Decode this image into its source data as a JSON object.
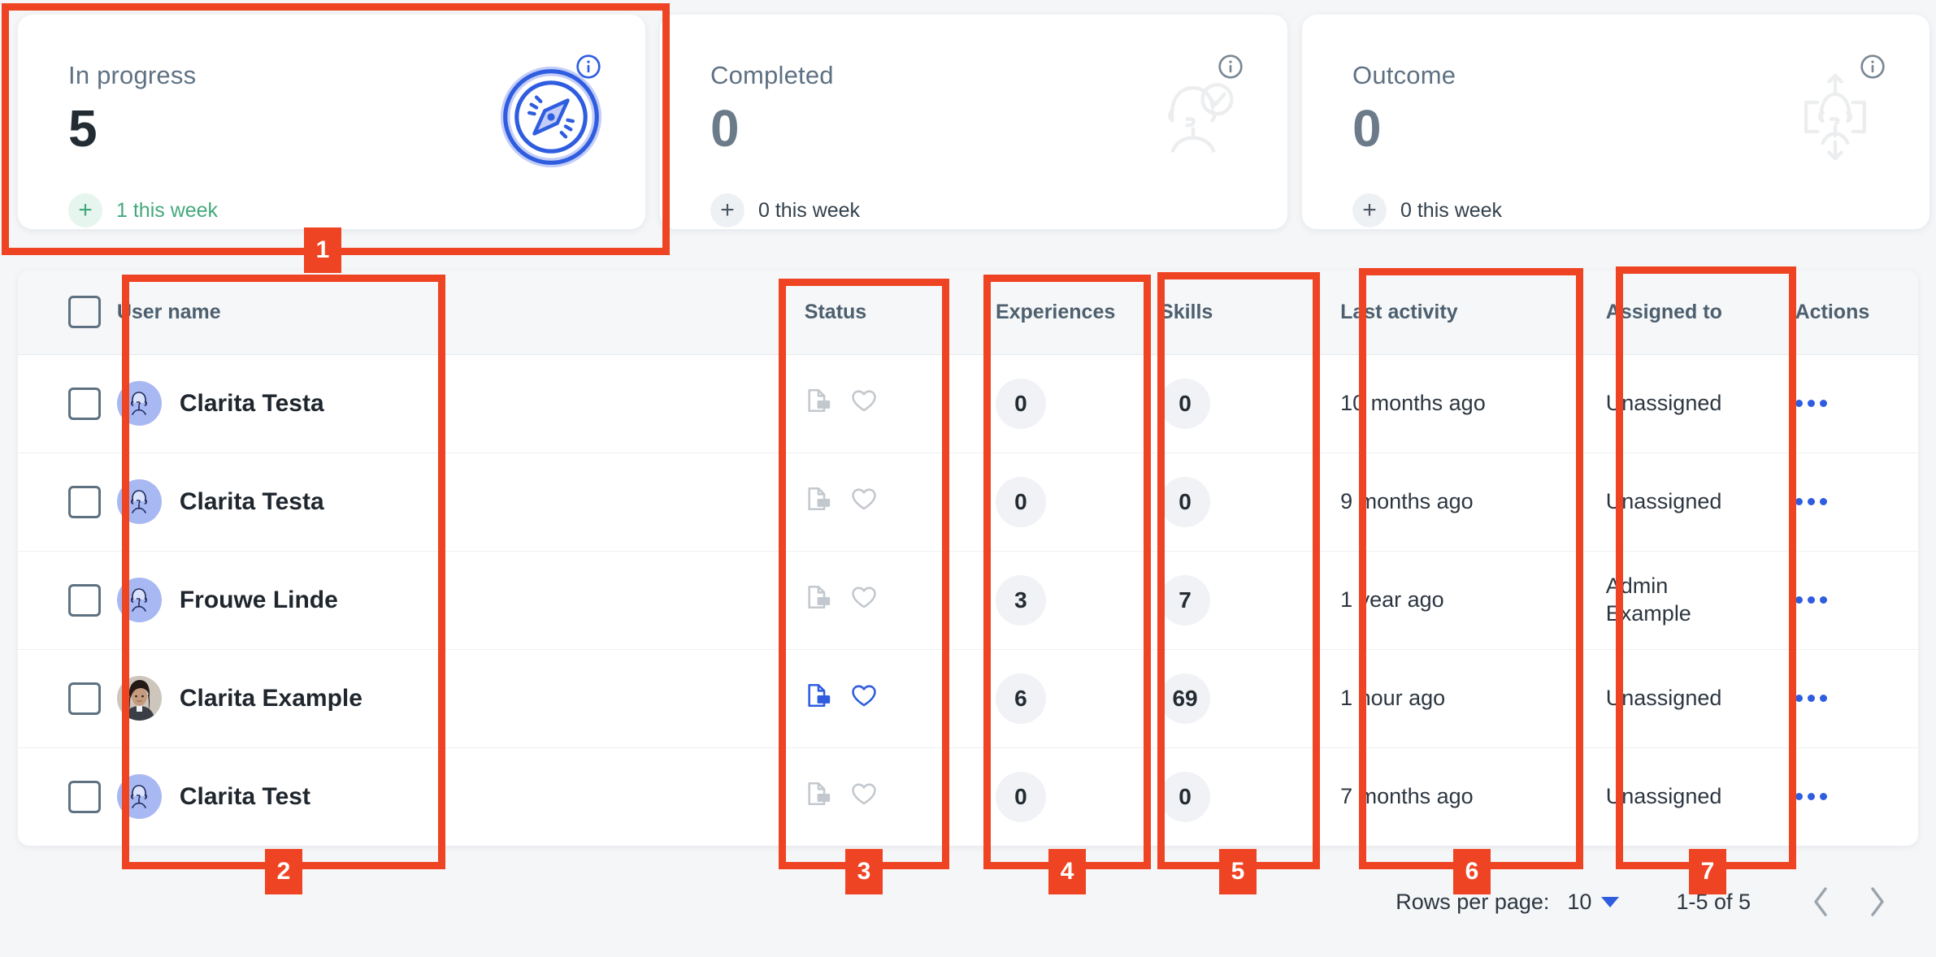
{
  "cards": [
    {
      "label": "In progress",
      "value": "5",
      "delta_plus": "+",
      "delta_text": "1 this week",
      "info_icon": "info-circle-icon",
      "art_icon": "compass-icon",
      "accent": "#2f5de0",
      "delta_color": "#43a97d",
      "style": "accent"
    },
    {
      "label": "Completed",
      "value": "0",
      "delta_plus": "+",
      "delta_text": "0 this week",
      "info_icon": "info-circle-icon",
      "art_icon": "person-check-icon",
      "accent": "#6b7b89",
      "delta_color": "#33414d",
      "style": "muted"
    },
    {
      "label": "Outcome",
      "value": "0",
      "delta_plus": "+",
      "delta_text": "0 this week",
      "info_icon": "info-circle-icon",
      "art_icon": "person-target-icon",
      "accent": "#6b7b89",
      "delta_color": "#33414d",
      "style": "muted"
    }
  ],
  "table": {
    "select_all_checkbox": "unchecked",
    "columns": [
      {
        "key": "checkbox",
        "label": ""
      },
      {
        "key": "name",
        "label": "User name"
      },
      {
        "key": "status",
        "label": "Status"
      },
      {
        "key": "experiences",
        "label": "Experiences"
      },
      {
        "key": "skills",
        "label": "Skills"
      },
      {
        "key": "last_activity",
        "label": "Last activity"
      },
      {
        "key": "assigned_to",
        "label": "Assigned to"
      },
      {
        "key": "actions",
        "label": "Actions"
      }
    ],
    "rows": [
      {
        "checked": false,
        "name": "Clarita Testa",
        "avatar": "avatar-illustration",
        "status_cv_active": false,
        "status_heart_active": false,
        "experiences": "0",
        "skills": "0",
        "last_activity": "10 months ago",
        "assigned_to": "Unassigned",
        "actions": "more-actions-icon"
      },
      {
        "checked": false,
        "name": "Clarita Testa",
        "avatar": "avatar-illustration",
        "status_cv_active": false,
        "status_heart_active": false,
        "experiences": "0",
        "skills": "0",
        "last_activity": "9 months ago",
        "assigned_to": "Unassigned",
        "actions": "more-actions-icon"
      },
      {
        "checked": false,
        "name": "Frouwe Linde",
        "avatar": "avatar-illustration",
        "status_cv_active": false,
        "status_heart_active": false,
        "experiences": "3",
        "skills": "7",
        "last_activity": "1 year ago",
        "assigned_to": "Admin Example",
        "actions": "more-actions-icon"
      },
      {
        "checked": false,
        "name": "Clarita Example",
        "avatar": "avatar-photo",
        "status_cv_active": true,
        "status_heart_active": true,
        "experiences": "6",
        "skills": "69",
        "last_activity": "1 hour ago",
        "assigned_to": "Unassigned",
        "actions": "more-actions-icon"
      },
      {
        "checked": false,
        "name": "Clarita Test",
        "avatar": "avatar-illustration",
        "status_cv_active": false,
        "status_heart_active": false,
        "experiences": "0",
        "skills": "0",
        "last_activity": "7 months ago",
        "assigned_to": "Unassigned",
        "actions": "more-actions-icon"
      }
    ]
  },
  "pagination": {
    "rows_per_page_label": "Rows per page:",
    "rows_per_page_value": "10",
    "caret_icon": "chevron-down-icon",
    "range": "1-5 of 5",
    "prev_icon": "chevron-left-icon",
    "next_icon": "chevron-right-icon"
  },
  "annotations": [
    {
      "n": "1",
      "target": "in-progress-card"
    },
    {
      "n": "2",
      "target": "user-name-column"
    },
    {
      "n": "3",
      "target": "status-column"
    },
    {
      "n": "4",
      "target": "experiences-column"
    },
    {
      "n": "5",
      "target": "skills-column"
    },
    {
      "n": "6",
      "target": "last-activity-column"
    },
    {
      "n": "7",
      "target": "assigned-to-column"
    }
  ],
  "colors": {
    "annotation": "#ef4423",
    "brand_blue": "#2f5de0",
    "green": "#43a97d",
    "muted": "#6b7b89",
    "page_bg": "#f4f6f8"
  }
}
